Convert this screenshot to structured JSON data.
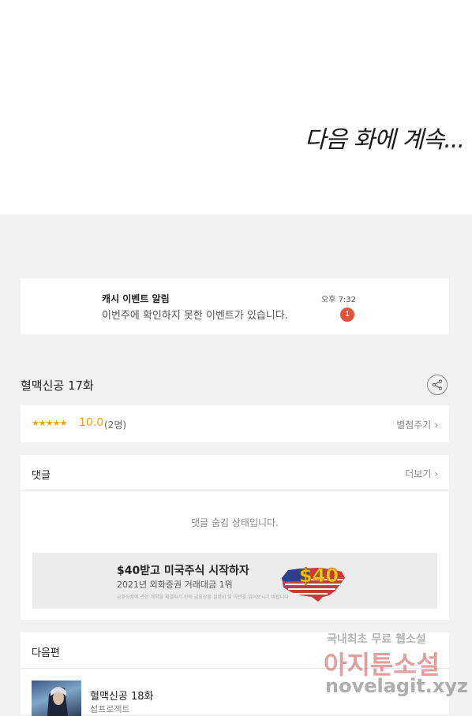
{
  "content": {
    "to_be_continued": "다음 화에 계속..."
  },
  "notice": {
    "title": "캐시 이벤트 알림",
    "description": "이번주에 확인하지 못한 이벤트가 있습니다.",
    "time": "오후 7:32",
    "badge_count": "1"
  },
  "episode": {
    "title": "혈맥신공 17화"
  },
  "rating": {
    "stars": "★★★★★",
    "score": "10.0",
    "count": "(2명)",
    "rate_link": "별점주기"
  },
  "comments": {
    "header": "댓글",
    "more": "더보기",
    "hidden_message": "댓글 숨김 상태입니다."
  },
  "ad": {
    "headline": "$40받고 미국주식 시작하자",
    "subline": "2021년 외화증권 거래대금 1위",
    "fine_print": "금융상품에 관한 계약을 체결하기 전에 금융상품 설명서 및 약관을 읽어보시기 바랍니다",
    "art_text": "$40"
  },
  "next": {
    "header": "다음편",
    "episode_title": "혈맥신공 18화",
    "author": "섭프로젝트"
  },
  "watermark": {
    "line1": "국내최초 무료 웹소설",
    "line2": "아지툰소설",
    "line3": "novelagit.xyz"
  },
  "colors": {
    "accent_star": "#f0a30a",
    "badge": "#e5533d"
  }
}
